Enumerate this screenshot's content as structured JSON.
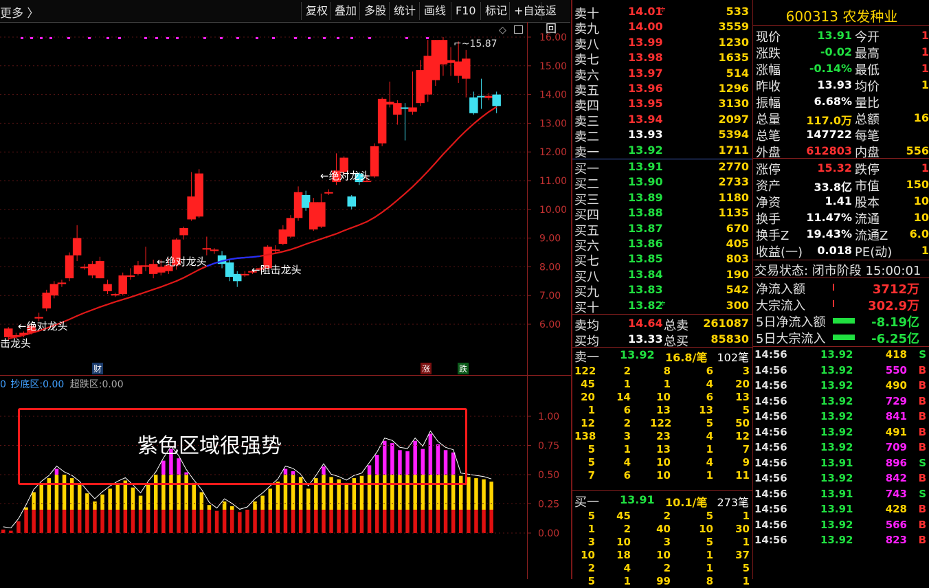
{
  "toolbar": {
    "more": "更多 〉",
    "buttons": [
      "复权",
      "叠加",
      "多股",
      "统计",
      "画线",
      "F10",
      "标记",
      "+自选",
      "返回"
    ]
  },
  "colors": {
    "up": "#ff2020",
    "down": "#40e0f0",
    "ma": "#e01818",
    "yellow": "#ffd400",
    "magenta": "#ff20ff",
    "green": "#20e040",
    "grid": "#8a1f1f"
  },
  "main_chart": {
    "price_ticks": [
      "16.00",
      "15.00",
      "14.00",
      "13.00",
      "12.00",
      "11.00",
      "10.00",
      "9.00",
      "8.00",
      "7.00",
      "6.00"
    ],
    "high_label": "15.87",
    "annotations": [
      "←绝对龙头",
      "←绝对龙头",
      "←绝对龙头",
      "←阻击龙头",
      "击龙头"
    ],
    "markers": [
      "财",
      "涨",
      "跌"
    ]
  },
  "chart_data": {
    "type": "candlestick",
    "y_range": [
      5.3,
      16.2
    ],
    "candles": [
      [
        5.55,
        5.85,
        5.45,
        5.9
      ],
      [
        5.55,
        5.62,
        5.5,
        5.7
      ],
      [
        5.62,
        5.7,
        5.55,
        5.75
      ],
      [
        5.7,
        5.95,
        5.65,
        6.05
      ],
      [
        6.2,
        6.25,
        6.1,
        6.4
      ],
      [
        6.55,
        7.1,
        6.45,
        7.2
      ],
      [
        7.0,
        7.4,
        6.9,
        7.5
      ],
      [
        7.4,
        7.45,
        7.3,
        7.55
      ],
      [
        7.6,
        8.4,
        7.5,
        8.5
      ],
      [
        8.4,
        9.0,
        8.2,
        9.45
      ],
      [
        8.0,
        8.0,
        7.9,
        8.1
      ],
      [
        7.7,
        8.1,
        7.6,
        8.2
      ],
      [
        7.6,
        8.2,
        7.6,
        8.35
      ],
      [
        7.15,
        7.4,
        7.05,
        7.55
      ],
      [
        7.05,
        7.05,
        6.95,
        7.1
      ],
      [
        7.05,
        7.7,
        7.0,
        7.8
      ],
      [
        7.65,
        7.7,
        7.55,
        7.95
      ],
      [
        7.75,
        8.05,
        7.7,
        8.2
      ],
      [
        8.0,
        8.05,
        7.85,
        8.7
      ],
      [
        7.75,
        8.1,
        7.6,
        8.25
      ],
      [
        7.8,
        8.0,
        7.7,
        8.25
      ],
      [
        7.85,
        8.05,
        7.75,
        8.3
      ],
      [
        8.05,
        8.95,
        7.9,
        9.0
      ],
      [
        9.1,
        9.35,
        8.95,
        9.4
      ],
      [
        9.65,
        10.45,
        9.6,
        11.3
      ],
      [
        9.75,
        11.25,
        9.7,
        11.4
      ],
      [
        8.6,
        8.65,
        8.4,
        9.05
      ],
      [
        8.55,
        8.6,
        8.45,
        8.65
      ],
      [
        8.4,
        8.1,
        7.95,
        8.55
      ],
      [
        8.15,
        7.65,
        7.5,
        8.25
      ],
      [
        7.75,
        7.5,
        7.3,
        7.85
      ],
      [
        7.7,
        7.75,
        7.65,
        7.85
      ],
      [
        7.8,
        7.85,
        7.75,
        7.9
      ],
      [
        7.9,
        7.95,
        7.85,
        8.0
      ],
      [
        7.95,
        8.7,
        7.9,
        8.75
      ],
      [
        8.6,
        8.6,
        8.45,
        8.75
      ],
      [
        8.8,
        9.3,
        8.75,
        9.45
      ],
      [
        9.05,
        9.7,
        9.0,
        9.8
      ],
      [
        9.7,
        10.6,
        9.6,
        10.8
      ],
      [
        10.5,
        10.05,
        9.95,
        10.65
      ],
      [
        9.3,
        10.25,
        9.25,
        10.4
      ],
      [
        9.4,
        10.25,
        9.35,
        10.55
      ],
      [
        10.6,
        10.6,
        10.5,
        10.7
      ],
      [
        10.95,
        11.35,
        10.85,
        11.95
      ],
      [
        11.3,
        11.8,
        11.2,
        11.85
      ],
      [
        10.45,
        10.1,
        10.0,
        10.5
      ],
      [
        11.25,
        10.95,
        10.85,
        11.3
      ],
      [
        10.95,
        11.0,
        10.95,
        11.2
      ],
      [
        11.15,
        12.2,
        11.1,
        12.3
      ],
      [
        12.3,
        13.85,
        12.2,
        13.9
      ],
      [
        13.65,
        13.75,
        13.55,
        14.45
      ],
      [
        13.3,
        13.7,
        12.95,
        13.8
      ],
      [
        13.55,
        13.5,
        12.4,
        13.7
      ],
      [
        13.4,
        13.55,
        13.3,
        14.8
      ],
      [
        13.7,
        14.85,
        13.6,
        15.2
      ],
      [
        14.0,
        15.35,
        13.75,
        15.9
      ],
      [
        14.5,
        15.9,
        14.3,
        15.9
      ],
      [
        15.05,
        15.9,
        14.65,
        16.0
      ],
      [
        15.1,
        15.2,
        14.65,
        15.65
      ],
      [
        14.65,
        15.15,
        14.4,
        15.85
      ],
      [
        14.55,
        15.25,
        13.9,
        15.55
      ],
      [
        13.9,
        13.35,
        13.3,
        14.1
      ],
      [
        13.95,
        13.9,
        13.5,
        14.55
      ],
      [
        13.88,
        13.95,
        13.8,
        14.05
      ],
      [
        14.0,
        13.6,
        13.35,
        14.1
      ]
    ],
    "ma": [
      5.5,
      5.56,
      5.62,
      5.69,
      5.77,
      5.86,
      5.96,
      6.06,
      6.17,
      6.29,
      6.4,
      6.5,
      6.6,
      6.69,
      6.78,
      6.86,
      6.94,
      7.03,
      7.12,
      7.21,
      7.3,
      7.4,
      7.5,
      7.62,
      7.76,
      7.9,
      8.02,
      8.12,
      8.2,
      8.26,
      8.3,
      8.32,
      8.34,
      8.37,
      8.42,
      8.47,
      8.53,
      8.6,
      8.69,
      8.79,
      8.88,
      8.97,
      9.06,
      9.15,
      9.26,
      9.36,
      9.46,
      9.57,
      9.72,
      9.9,
      10.1,
      10.32,
      10.55,
      10.79,
      11.05,
      11.33,
      11.62,
      11.92,
      12.2,
      12.48,
      12.74,
      12.98,
      13.2,
      13.4,
      13.57
    ]
  },
  "sub_chart": {
    "legend": {
      "prefix": "0",
      "dip_label": "抄底区:",
      "dip_value": "0.00",
      "over_label": "超跌区:",
      "over_value": "0.00"
    },
    "ticks": [
      "1.00",
      "0.75",
      "0.50",
      "0.25",
      "0.00"
    ],
    "box_text": "紫色区域很强势",
    "values": [
      0.03,
      0.02,
      0.1,
      0.22,
      0.35,
      0.42,
      0.47,
      0.55,
      0.5,
      0.47,
      0.42,
      0.34,
      0.27,
      0.33,
      0.38,
      0.42,
      0.45,
      0.39,
      0.32,
      0.42,
      0.5,
      0.62,
      0.72,
      0.64,
      0.52,
      0.43,
      0.35,
      0.24,
      0.19,
      0.27,
      0.23,
      0.18,
      0.2,
      0.27,
      0.32,
      0.38,
      0.44,
      0.55,
      0.53,
      0.48,
      0.38,
      0.47,
      0.57,
      0.48,
      0.46,
      0.43,
      0.47,
      0.49,
      0.58,
      0.67,
      0.79,
      0.77,
      0.71,
      0.7,
      0.79,
      0.72,
      0.85,
      0.76,
      0.71,
      0.69,
      0.49,
      0.48,
      0.47,
      0.46,
      0.44
    ]
  },
  "orderbook": {
    "sell": [
      {
        "label": "卖十",
        "price": "14.01",
        "vol": "533",
        "mark": "≑"
      },
      {
        "label": "卖九",
        "price": "14.00",
        "vol": "3559"
      },
      {
        "label": "卖八",
        "price": "13.99",
        "vol": "1230"
      },
      {
        "label": "卖七",
        "price": "13.98",
        "vol": "1635"
      },
      {
        "label": "卖六",
        "price": "13.97",
        "vol": "514"
      },
      {
        "label": "卖五",
        "price": "13.96",
        "vol": "1296"
      },
      {
        "label": "卖四",
        "price": "13.95",
        "vol": "3130"
      },
      {
        "label": "卖三",
        "price": "13.94",
        "vol": "2097"
      },
      {
        "label": "卖二",
        "price": "13.93",
        "vol": "5394"
      },
      {
        "label": "卖一",
        "price": "13.92",
        "vol": "1711"
      }
    ],
    "buy": [
      {
        "label": "买一",
        "price": "13.91",
        "vol": "2770"
      },
      {
        "label": "买二",
        "price": "13.90",
        "vol": "2733"
      },
      {
        "label": "买三",
        "price": "13.89",
        "vol": "1180"
      },
      {
        "label": "买四",
        "price": "13.88",
        "vol": "1135"
      },
      {
        "label": "买五",
        "price": "13.87",
        "vol": "670"
      },
      {
        "label": "买六",
        "price": "13.86",
        "vol": "405"
      },
      {
        "label": "买七",
        "price": "13.85",
        "vol": "803"
      },
      {
        "label": "买八",
        "price": "13.84",
        "vol": "190"
      },
      {
        "label": "买九",
        "price": "13.83",
        "vol": "542"
      },
      {
        "label": "买十",
        "price": "13.82",
        "vol": "300",
        "mark": "≑"
      }
    ],
    "avg_sell": {
      "label": "卖均",
      "price": "14.64",
      "tlabel": "总卖",
      "total": "261087"
    },
    "avg_buy": {
      "label": "买均",
      "price": "13.33",
      "tlabel": "总买",
      "total": "85830"
    }
  },
  "queue_sell": {
    "label": "卖一",
    "price": "13.92",
    "size": "16.8/笔",
    "count": "102笔",
    "rows": [
      [
        "122",
        "2",
        "8",
        "6",
        "3"
      ],
      [
        "45",
        "1",
        "1",
        "4",
        "20"
      ],
      [
        "20",
        "14",
        "10",
        "6",
        "13"
      ],
      [
        "1",
        "6",
        "13",
        "13",
        "5"
      ],
      [
        "12",
        "2",
        "122",
        "5",
        "50"
      ],
      [
        "138",
        "3",
        "23",
        "4",
        "12"
      ],
      [
        "5",
        "1",
        "13",
        "1",
        "7"
      ],
      [
        "5",
        "4",
        "10",
        "4",
        "9"
      ],
      [
        "7",
        "6",
        "10",
        "1",
        "11"
      ]
    ]
  },
  "queue_buy": {
    "label": "买一",
    "price": "13.91",
    "size": "10.1/笔",
    "count": "273笔",
    "rows": [
      [
        "5",
        "45",
        "2",
        "5",
        "1"
      ],
      [
        "1",
        "2",
        "40",
        "10",
        "30"
      ],
      [
        "3",
        "10",
        "3",
        "5",
        "1"
      ],
      [
        "10",
        "18",
        "10",
        "1",
        "37"
      ],
      [
        "2",
        "4",
        "2",
        "1",
        "5"
      ],
      [
        "5",
        "1",
        "99",
        "8",
        "1"
      ]
    ]
  },
  "stock": {
    "code": "600313",
    "name": "农发种业"
  },
  "quotes": [
    {
      "l": "现价",
      "v": "13.91",
      "c": "#20e040",
      "l2": "今开",
      "v2": "1"
    },
    {
      "l": "涨跌",
      "v": "-0.02",
      "c": "#20e040",
      "l2": "最高",
      "v2": "1"
    },
    {
      "l": "涨幅",
      "v": "-0.14%",
      "c": "#20e040",
      "l2": "最低",
      "v2": "1"
    },
    {
      "l": "昨收",
      "v": "13.93",
      "c": "#ffffff",
      "l2": "均价",
      "v2": "1"
    },
    {
      "l": "振幅",
      "v": "6.68%",
      "c": "#ffffff",
      "l2": "量比",
      "v2": ""
    },
    {
      "l": "总量",
      "v": "117.0万",
      "c": "#ffd400",
      "l2": "总额",
      "v2": "16"
    },
    {
      "l": "总笔",
      "v": "147722",
      "c": "#ffffff",
      "l2": "每笔",
      "v2": ""
    },
    {
      "l": "外盘",
      "v": "612803",
      "c": "#ff3030",
      "l2": "内盘",
      "v2": "556"
    }
  ],
  "quotes2": [
    {
      "l": "涨停",
      "v": "15.32",
      "c": "#ff3030",
      "l2": "跌停",
      "v2": "1"
    },
    {
      "l": "资产",
      "v": "33.8亿",
      "c": "#ffffff",
      "l2": "市值",
      "v2": "150"
    },
    {
      "l": "净资",
      "v": "1.41",
      "c": "#ffffff",
      "l2": "股本",
      "v2": "10"
    },
    {
      "l": "换手",
      "v": "11.47%",
      "c": "#ffffff",
      "l2": "流通",
      "v2": "10"
    },
    {
      "l": "换手Z",
      "v": "19.43%",
      "c": "#ffffff",
      "l2": "流通Z",
      "v2": "6.0"
    },
    {
      "l": "收益(一)",
      "v": "0.018",
      "c": "#ffffff",
      "l2": "PE(动)",
      "v2": "1"
    }
  ],
  "trade_status": "交易状态: 闭市阶段 15:00:01",
  "flows": [
    {
      "l": "净流入额",
      "v": "3712万",
      "c": "#ff3030",
      "bar": ""
    },
    {
      "l": "大宗流入",
      "v": "302.9万",
      "c": "#ff3030",
      "bar": ""
    },
    {
      "l": "5日净流入额",
      "v": "-8.19亿",
      "c": "#20e040",
      "bar": "g"
    },
    {
      "l": "5日大宗流入",
      "v": "-6.25亿",
      "c": "#20e040",
      "bar": "g"
    }
  ],
  "ticks": [
    {
      "t": "14:56",
      "p": "13.92",
      "pc": "#20e040",
      "v": "418",
      "vc": "#ffd400",
      "s": "S",
      "sc": "#20e040"
    },
    {
      "t": "14:56",
      "p": "13.92",
      "pc": "#20e040",
      "v": "550",
      "vc": "#ff20ff",
      "s": "B",
      "sc": "#ff3030"
    },
    {
      "t": "14:56",
      "p": "13.92",
      "pc": "#20e040",
      "v": "490",
      "vc": "#ffd400",
      "s": "B",
      "sc": "#ff3030"
    },
    {
      "t": "14:56",
      "p": "13.92",
      "pc": "#20e040",
      "v": "729",
      "vc": "#ff20ff",
      "s": "B",
      "sc": "#ff3030"
    },
    {
      "t": "14:56",
      "p": "13.92",
      "pc": "#20e040",
      "v": "841",
      "vc": "#ff20ff",
      "s": "B",
      "sc": "#ff3030"
    },
    {
      "t": "14:56",
      "p": "13.92",
      "pc": "#20e040",
      "v": "491",
      "vc": "#ffd400",
      "s": "B",
      "sc": "#ff3030"
    },
    {
      "t": "14:56",
      "p": "13.92",
      "pc": "#20e040",
      "v": "709",
      "vc": "#ff20ff",
      "s": "B",
      "sc": "#ff3030"
    },
    {
      "t": "14:56",
      "p": "13.91",
      "pc": "#20e040",
      "v": "896",
      "vc": "#ff20ff",
      "s": "S",
      "sc": "#20e040"
    },
    {
      "t": "14:56",
      "p": "13.92",
      "pc": "#20e040",
      "v": "842",
      "vc": "#ff20ff",
      "s": "B",
      "sc": "#ff3030"
    },
    {
      "t": "14:56",
      "p": "13.91",
      "pc": "#20e040",
      "v": "743",
      "vc": "#ff20ff",
      "s": "S",
      "sc": "#20e040"
    },
    {
      "t": "14:56",
      "p": "13.91",
      "pc": "#20e040",
      "v": "428",
      "vc": "#ffd400",
      "s": "B",
      "sc": "#ff3030"
    },
    {
      "t": "14:56",
      "p": "13.92",
      "pc": "#20e040",
      "v": "566",
      "vc": "#ff20ff",
      "s": "B",
      "sc": "#ff3030"
    },
    {
      "t": "14:56",
      "p": "13.92",
      "pc": "#20e040",
      "v": "823",
      "vc": "#ff20ff",
      "s": "B",
      "sc": "#ff3030"
    }
  ]
}
